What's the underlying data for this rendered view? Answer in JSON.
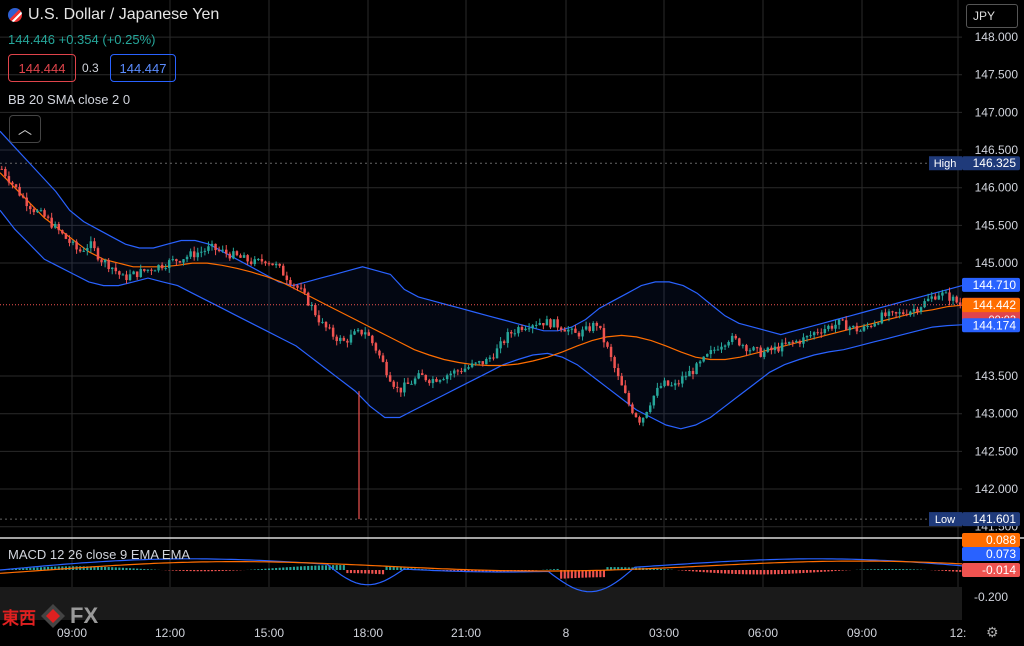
{
  "header": {
    "title": "U.S. Dollar / Japanese Yen",
    "last": "144.446",
    "change": "+0.354",
    "change_pct": "(+0.25%)",
    "sell": "144.444",
    "spread": "0.3",
    "buy": "144.447",
    "currency": "JPY"
  },
  "indicators": {
    "bb": "BB 20 SMA close 2 0",
    "macd": "MACD 12 26 close 9 EMA EMA"
  },
  "logo": {
    "cn": "東西",
    "fx": "FX"
  },
  "colors": {
    "up": "#26a69a",
    "down": "#ef5350",
    "bb_band": "#2962ff",
    "bb_basis": "#ff6d00",
    "grid": "#2a2a2a"
  },
  "chart_data": {
    "type": "candlestick",
    "title": "U.S. Dollar / Japanese Yen",
    "ylim": [
      141.35,
      148.2
    ],
    "yticks": [
      "148.000",
      "147.500",
      "147.000",
      "146.500",
      "146.000",
      "145.500",
      "145.000",
      "143.500",
      "143.000",
      "142.500",
      "142.000",
      "141.500"
    ],
    "xticks": [
      "09:00",
      "12:00",
      "15:00",
      "18:00",
      "21:00",
      "8",
      "03:00",
      "06:00",
      "09:00",
      "12:"
    ],
    "grid": true,
    "price_markers": [
      {
        "label": "High",
        "value": "146.325",
        "y": 146.325,
        "color": "#1f3a7a"
      },
      {
        "label": "",
        "value": "144.710",
        "y": 144.71,
        "color": "#2962ff"
      },
      {
        "label": "",
        "value": "144.446",
        "sub": "00:02",
        "y": 144.446,
        "color": "#e0444b"
      },
      {
        "label": "",
        "value": "144.442",
        "y": 144.442,
        "color": "#ff6d00"
      },
      {
        "label": "",
        "value": "144.174",
        "y": 144.174,
        "color": "#2962ff"
      },
      {
        "label": "Low",
        "value": "141.601",
        "y": 141.601,
        "color": "#1f3a7a"
      }
    ],
    "close_series": [
      146.25,
      146.05,
      145.85,
      145.7,
      145.6,
      145.45,
      145.3,
      145.15,
      145.25,
      145.05,
      144.95,
      144.8,
      144.85,
      144.9,
      144.95,
      145.0,
      145.05,
      145.1,
      145.15,
      145.2,
      145.15,
      145.1,
      145.05,
      145.0,
      145.05,
      144.95,
      144.8,
      144.65,
      144.45,
      144.2,
      144.05,
      143.95,
      144.05,
      144.1,
      143.85,
      143.55,
      143.3,
      143.4,
      143.5,
      143.45,
      143.5,
      143.55,
      143.6,
      143.65,
      143.7,
      143.85,
      144.05,
      144.15,
      144.2,
      144.22,
      144.2,
      144.15,
      144.05,
      144.1,
      144.2,
      143.85,
      143.45,
      143.1,
      142.9,
      143.2,
      143.4,
      143.35,
      143.5,
      143.6,
      143.75,
      143.9,
      144.0,
      143.95,
      143.85,
      143.8,
      143.85,
      143.9,
      143.95,
      144.0,
      144.1,
      144.15,
      144.2,
      144.15,
      144.1,
      144.2,
      144.3,
      144.3,
      144.35,
      144.4,
      144.5,
      144.6,
      144.55,
      144.45
    ],
    "bb_upper": [
      146.75,
      146.55,
      146.35,
      146.15,
      145.95,
      145.7,
      145.55,
      145.45,
      145.35,
      145.25,
      145.2,
      145.2,
      145.25,
      145.3,
      145.3,
      145.25,
      145.15,
      145.05,
      144.95,
      144.85,
      144.75,
      144.7,
      144.75,
      144.8,
      144.85,
      144.9,
      144.95,
      144.9,
      144.85,
      144.65,
      144.55,
      144.5,
      144.45,
      144.4,
      144.35,
      144.3,
      144.25,
      144.2,
      144.15,
      144.1,
      144.1,
      144.15,
      144.25,
      144.4,
      144.5,
      144.6,
      144.7,
      144.75,
      144.75,
      144.7,
      144.6,
      144.45,
      144.3,
      144.2,
      144.15,
      144.1,
      144.05,
      144.1,
      144.15,
      144.2,
      144.25,
      144.3,
      144.35,
      144.4,
      144.45,
      144.5,
      144.55,
      144.6,
      144.65,
      144.7
    ],
    "bb_basis": [
      146.2,
      146.0,
      145.8,
      145.6,
      145.45,
      145.3,
      145.15,
      145.05,
      145.0,
      144.95,
      144.95,
      144.95,
      144.97,
      145.0,
      145.0,
      144.97,
      144.93,
      144.88,
      144.82,
      144.75,
      144.65,
      144.55,
      144.45,
      144.35,
      144.25,
      144.15,
      144.05,
      143.95,
      143.85,
      143.78,
      143.72,
      143.68,
      143.65,
      143.64,
      143.64,
      143.66,
      143.7,
      143.75,
      143.82,
      143.9,
      143.97,
      144.02,
      144.04,
      144.02,
      143.97,
      143.9,
      143.82,
      143.75,
      143.72,
      143.72,
      143.75,
      143.8,
      143.85,
      143.9,
      143.95,
      144.0,
      144.05,
      144.1,
      144.15,
      144.2,
      144.25,
      144.3,
      144.35,
      144.38,
      144.42,
      144.44
    ],
    "bb_lower": [
      145.7,
      145.45,
      145.25,
      145.05,
      144.95,
      144.85,
      144.75,
      144.7,
      144.7,
      144.75,
      144.8,
      144.75,
      144.7,
      144.6,
      144.5,
      144.4,
      144.3,
      144.2,
      144.1,
      144.0,
      143.9,
      143.75,
      143.6,
      143.45,
      143.3,
      143.1,
      142.95,
      142.95,
      143.05,
      143.15,
      143.25,
      143.35,
      143.45,
      143.55,
      143.65,
      143.72,
      143.78,
      143.8,
      143.75,
      143.65,
      143.5,
      143.35,
      143.2,
      143.05,
      142.95,
      142.85,
      142.8,
      142.85,
      142.95,
      143.1,
      143.25,
      143.4,
      143.55,
      143.65,
      143.72,
      143.78,
      143.82,
      143.85,
      143.9,
      143.95,
      144.0,
      144.05,
      144.1,
      144.15,
      144.17,
      144.18
    ]
  },
  "macd_panel": {
    "yticks": [
      "-0.200"
    ],
    "markers": [
      {
        "value": "0.088",
        "color": "#ff6d00"
      },
      {
        "value": "0.073",
        "color": "#2962ff"
      },
      {
        "value": "-0.014",
        "color": "#ef5350"
      }
    ]
  }
}
